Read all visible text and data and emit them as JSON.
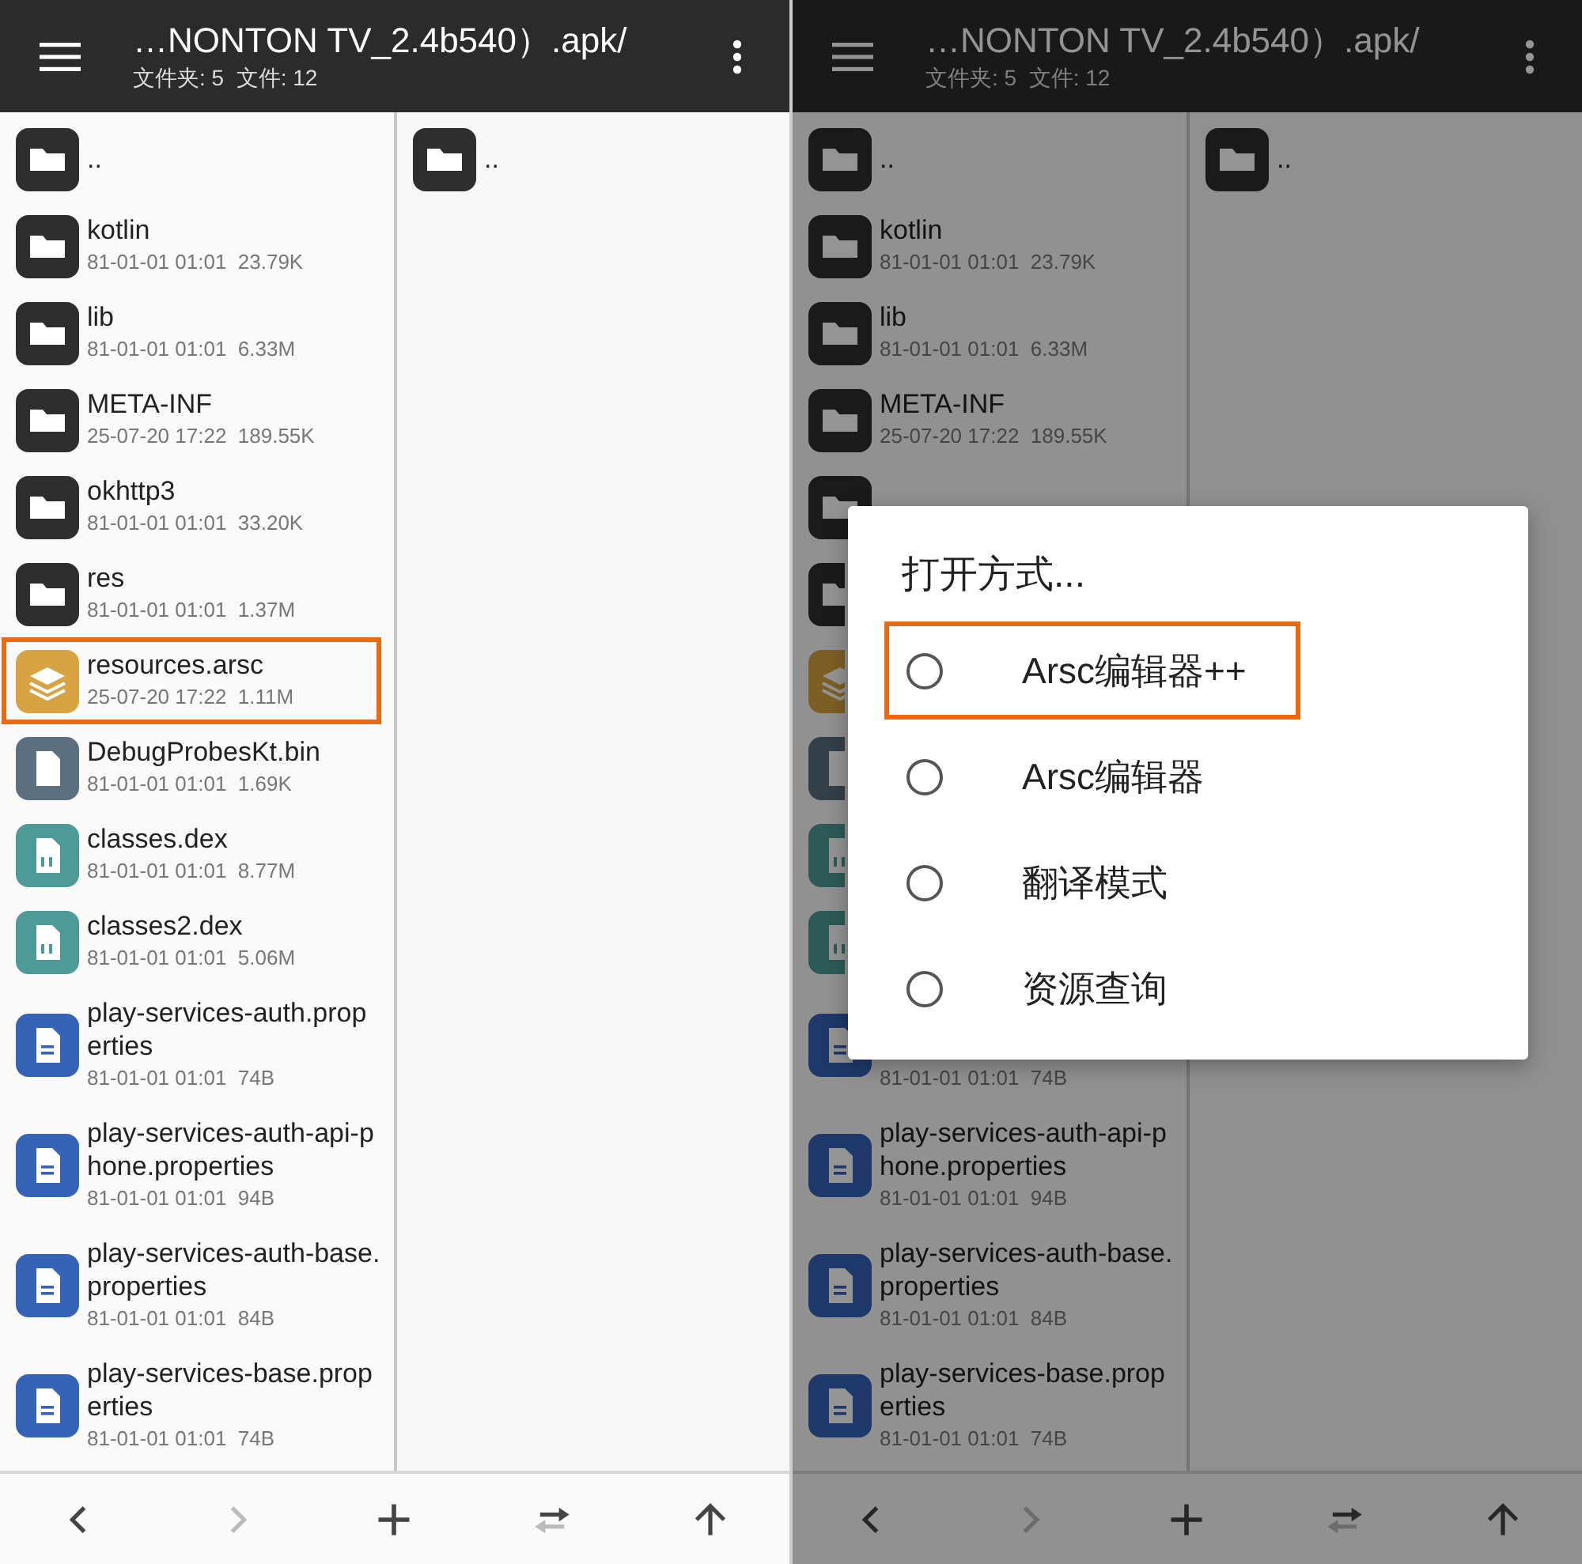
{
  "panels": [
    {
      "dimmed": false,
      "header": {
        "title": "…NONTON TV_2.4b540）.apk/",
        "subtitle": "文件夹: 5  文件: 12"
      },
      "rows": [
        {
          "kind": "folder",
          "name": "..",
          "tall": false,
          "highlighted": false
        },
        {
          "kind": "folder",
          "name": "kotlin",
          "meta": "81-01-01 01:01  23.79K",
          "tall": false,
          "highlighted": false
        },
        {
          "kind": "folder",
          "name": "lib",
          "meta": "81-01-01 01:01  6.33M",
          "tall": false,
          "highlighted": false
        },
        {
          "kind": "folder",
          "name": "META-INF",
          "meta": "25-07-20 17:22  189.55K",
          "tall": false,
          "highlighted": false
        },
        {
          "kind": "folder",
          "name": "okhttp3",
          "meta": "81-01-01 01:01  33.20K",
          "tall": false,
          "highlighted": false
        },
        {
          "kind": "folder",
          "name": "res",
          "meta": "81-01-01 01:01  1.37M",
          "tall": false,
          "highlighted": false
        },
        {
          "kind": "arsc",
          "name": "resources.arsc",
          "meta": "25-07-20 17:22  1.11M",
          "tall": false,
          "highlighted": true
        },
        {
          "kind": "binary",
          "name": "DebugProbesKt.bin",
          "meta": "81-01-01 01:01  1.69K",
          "tall": false,
          "highlighted": false
        },
        {
          "kind": "dex",
          "name": "classes.dex",
          "meta": "81-01-01 01:01  8.77M",
          "tall": false,
          "highlighted": false
        },
        {
          "kind": "dex",
          "name": "classes2.dex",
          "meta": "81-01-01 01:01  5.06M",
          "tall": false,
          "highlighted": false
        },
        {
          "kind": "text",
          "name": "play-services-auth.properties",
          "meta": "81-01-01 01:01  74B",
          "tall": true,
          "highlighted": false
        },
        {
          "kind": "text",
          "name": "play-services-auth-api-phone.properties",
          "meta": "81-01-01 01:01  94B",
          "tall": true,
          "highlighted": false
        },
        {
          "kind": "text",
          "name": "play-services-auth-base.properties",
          "meta": "81-01-01 01:01  84B",
          "tall": true,
          "highlighted": false
        },
        {
          "kind": "text",
          "name": "play-services-base.properties",
          "meta": "81-01-01 01:01  74B",
          "tall": true,
          "highlighted": false
        }
      ],
      "side_rows": [
        {
          "kind": "folder",
          "name": ".."
        }
      ],
      "toolbar": [
        {
          "kind": "back",
          "disabled": false
        },
        {
          "kind": "forward",
          "disabled": true
        },
        {
          "kind": "add",
          "disabled": false
        },
        {
          "kind": "swap",
          "disabled": false
        },
        {
          "kind": "up",
          "disabled": false
        }
      ]
    },
    {
      "dimmed": true,
      "header": {
        "title": "…NONTON TV_2.4b540）.apk/",
        "subtitle": "文件夹: 5  文件: 12"
      },
      "rows": [
        {
          "kind": "folder",
          "name": "..",
          "tall": false,
          "highlighted": false,
          "covered": false
        },
        {
          "kind": "folder",
          "name": "kotlin",
          "meta": "81-01-01 01:01  23.79K",
          "tall": false,
          "highlighted": false,
          "covered": false
        },
        {
          "kind": "folder",
          "name": "lib",
          "meta": "81-01-01 01:01  6.33M",
          "tall": false,
          "highlighted": false,
          "covered": false
        },
        {
          "kind": "folder",
          "name": "META-INF",
          "meta": "25-07-20 17:22  189.55K",
          "tall": false,
          "highlighted": false,
          "covered": false
        },
        {
          "kind": "folder",
          "tall": false,
          "highlighted": false,
          "covered": false
        },
        {
          "kind": "folder",
          "tall": false,
          "highlighted": false,
          "covered": true
        },
        {
          "kind": "arsc",
          "tall": false,
          "highlighted": false,
          "covered": true
        },
        {
          "kind": "binary",
          "tall": false,
          "highlighted": false,
          "covered": true
        },
        {
          "kind": "dex",
          "tall": false,
          "highlighted": false,
          "covered": true
        },
        {
          "kind": "dex",
          "tall": false,
          "highlighted": false,
          "covered": true
        },
        {
          "kind": "text",
          "meta": "81-01-01 01:01  74B",
          "tall": true,
          "highlighted": false,
          "covered": false
        },
        {
          "kind": "text",
          "name": "play-services-auth-api-phone.properties",
          "meta": "81-01-01 01:01  94B",
          "tall": true,
          "highlighted": false,
          "covered": false
        },
        {
          "kind": "text",
          "name": "play-services-auth-base.properties",
          "meta": "81-01-01 01:01  84B",
          "tall": true,
          "highlighted": false,
          "covered": false
        },
        {
          "kind": "text",
          "name": "play-services-base.properties",
          "meta": "81-01-01 01:01  74B",
          "tall": true,
          "highlighted": false,
          "covered": false
        }
      ],
      "side_rows": [
        {
          "kind": "folder",
          "name": ".."
        }
      ],
      "toolbar": [
        {
          "kind": "back",
          "disabled": false
        },
        {
          "kind": "forward",
          "disabled": true
        },
        {
          "kind": "add",
          "disabled": false
        },
        {
          "kind": "swap",
          "disabled": false
        },
        {
          "kind": "up",
          "disabled": false
        }
      ],
      "dialog": {
        "title": "打开方式...",
        "options": [
          {
            "label": "Arsc编辑器++",
            "selected": false,
            "highlighted": true
          },
          {
            "label": "Arsc编辑器",
            "selected": false,
            "highlighted": false
          },
          {
            "label": "翻译模式",
            "selected": false,
            "highlighted": false
          },
          {
            "label": "资源查询",
            "selected": false,
            "highlighted": false
          }
        ]
      }
    }
  ]
}
